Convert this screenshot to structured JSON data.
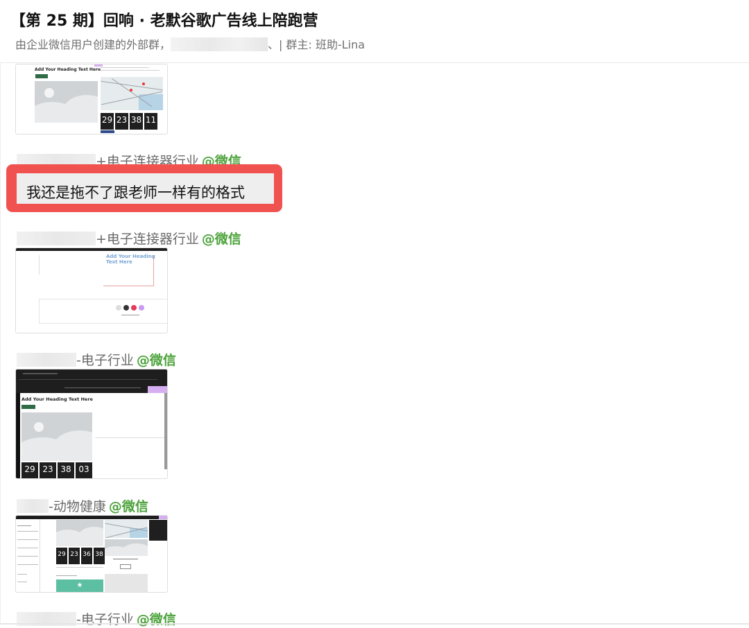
{
  "header": {
    "title": "【第 25 期】回响 · 老默谷歌广告线上陪跑营",
    "subtitle_prefix": "由企业微信用户创建的外部群，",
    "subtitle_suffix": "、| 群主: 班助-Lina"
  },
  "messages": [
    {
      "sender_suffix": "+电子连接器行业",
      "tag": "@微信"
    },
    {
      "text": "我还是拖不了跟老师一样有的格式"
    },
    {
      "sender_suffix": "+电子连接器行业",
      "tag": "@微信"
    },
    {
      "sender_suffix": "-电子行业",
      "tag": "@微信"
    },
    {
      "sender_suffix": "-动物健康",
      "tag": "@微信"
    },
    {
      "sender_suffix": "-电子行业",
      "tag": "@微信"
    }
  ],
  "thumbnails": {
    "heading": "Add Your Heading Text Here",
    "heading_line1": "Add Your Heading",
    "heading_line2": "Text Here",
    "countdown_a": [
      "29",
      "23",
      "38",
      "11"
    ],
    "countdown_b": [
      "29",
      "23",
      "38",
      "03"
    ],
    "countdown_c": [
      "29",
      "23",
      "36",
      "38"
    ]
  },
  "colors": {
    "highlight": "#f0524f",
    "wechat_tag": "#4ba23a",
    "placeholder": "#cfd3d6"
  }
}
